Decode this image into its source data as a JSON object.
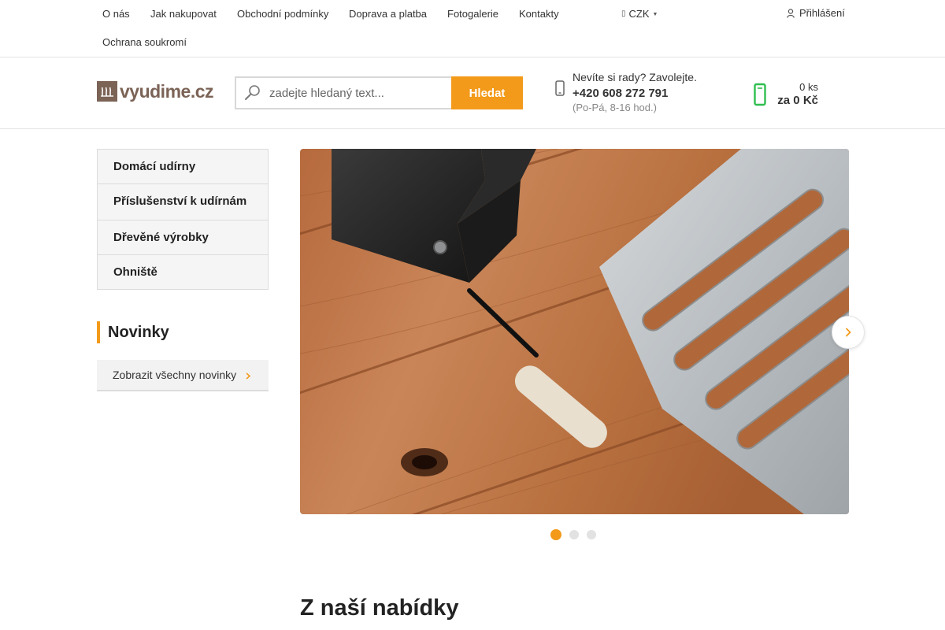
{
  "top_nav": {
    "items": [
      "O nás",
      "Jak nakupovat",
      "Obchodní podmínky",
      "Doprava a platba",
      "Fotogalerie",
      "Kontakty",
      "Ochrana soukromí"
    ],
    "currency": "CZK",
    "login": "Přihlášení"
  },
  "header": {
    "logo_text": "vyudime.cz",
    "search": {
      "placeholder": "zadejte hledaný text...",
      "button": "Hledat"
    },
    "contact": {
      "question": "Nevíte si rady? Zavolejte.",
      "phone": "+420 608 272 791",
      "hours": "(Po-Pá, 8-16 hod.)"
    },
    "cart": {
      "count": "0 ks",
      "price": "za 0 Kč"
    }
  },
  "sidebar": {
    "categories": [
      "Domácí udírny",
      "Příslušenství k udírnám",
      "Dřevěné výrobky",
      "Ohniště"
    ],
    "news_title": "Novinky",
    "news_button": "Zobrazit všechny novinky"
  },
  "slider": {
    "total": 3,
    "active": 1
  },
  "main": {
    "section_title": "Z naší nabídky"
  },
  "colors": {
    "accent": "#f39a1a",
    "brand": "#7b6356",
    "cart_green": "#2fbf4f"
  },
  "icons": [
    "search-icon",
    "phone-icon",
    "cart-icon",
    "user-icon",
    "chevron-right-icon",
    "caret-down-icon",
    "logo-icon"
  ]
}
